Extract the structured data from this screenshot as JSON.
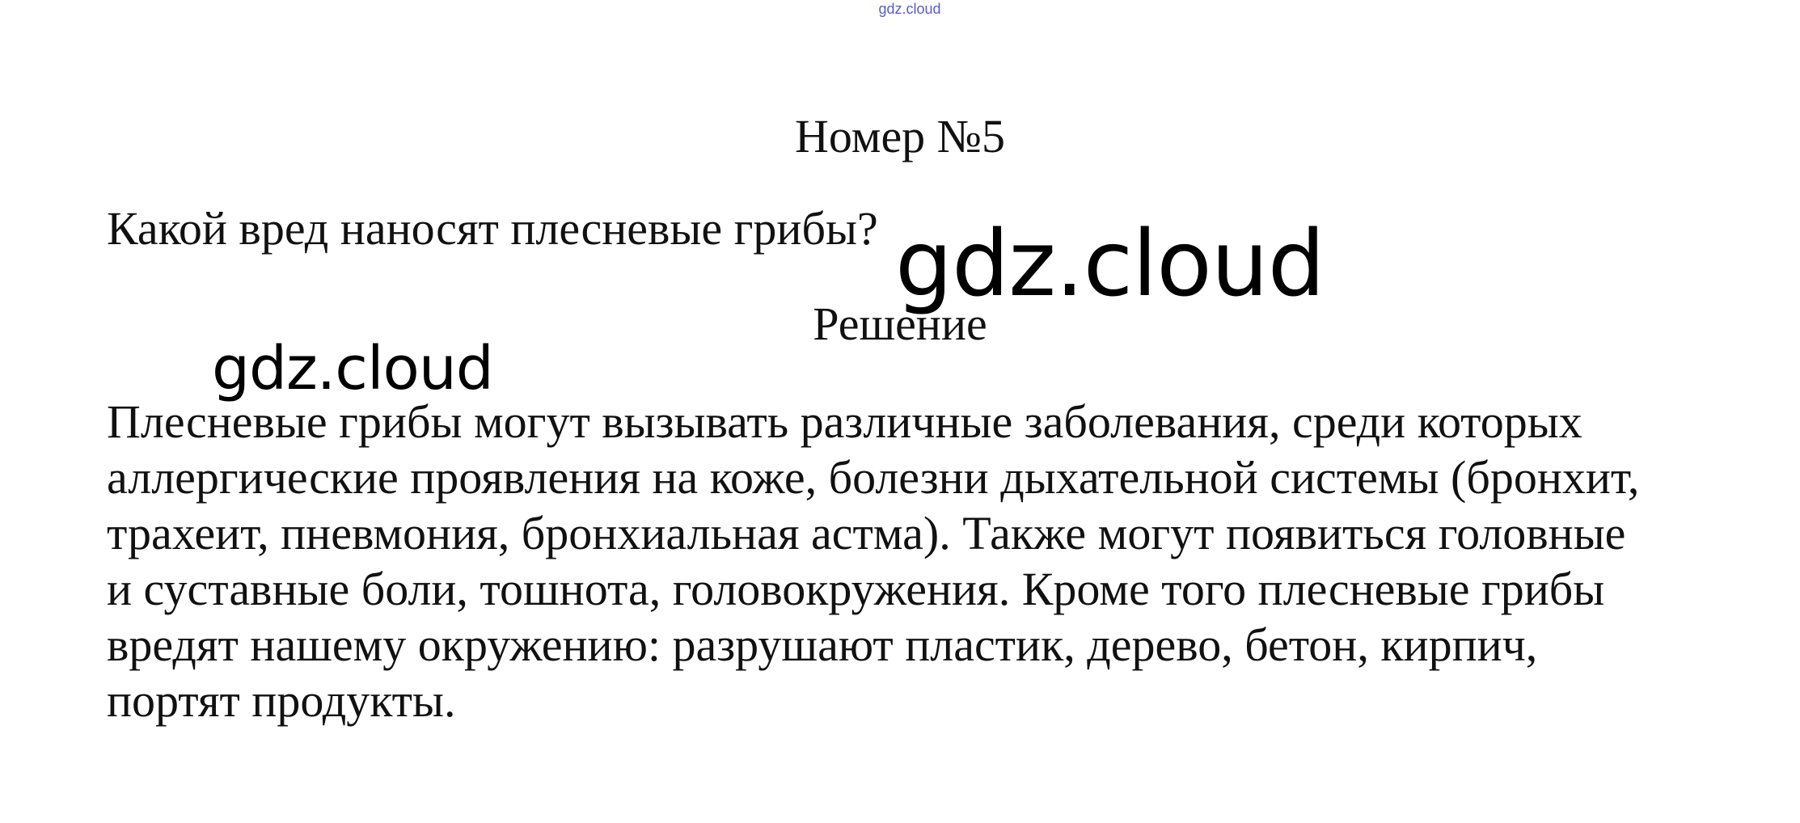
{
  "header": {
    "site_link": "gdz.cloud"
  },
  "document": {
    "title": "Номер №5",
    "question": "Какой вред наносят плесневые грибы?",
    "solution_label": "Решение",
    "answer_lines": [
      "Плесневые грибы могут вызывать различные заболевания, среди которых",
      "аллергические проявления на коже, болезни дыхательной системы (бронхит,",
      "трахеит, пневмония, бронхиальная астма). Также могут появиться головные",
      "и суставные боли, тошнота, головокружения. Кроме того плесневые грибы",
      "вредят нашему окружению: разрушают пластик, дерево, бетон, кирпич,",
      "портят продукты."
    ]
  },
  "watermarks": {
    "large": "gdz.cloud",
    "small": "gdz.cloud"
  },
  "colors": {
    "background": "#ffffff",
    "text": "#111111",
    "link": "#5a5ad6",
    "watermark": "#000000"
  }
}
